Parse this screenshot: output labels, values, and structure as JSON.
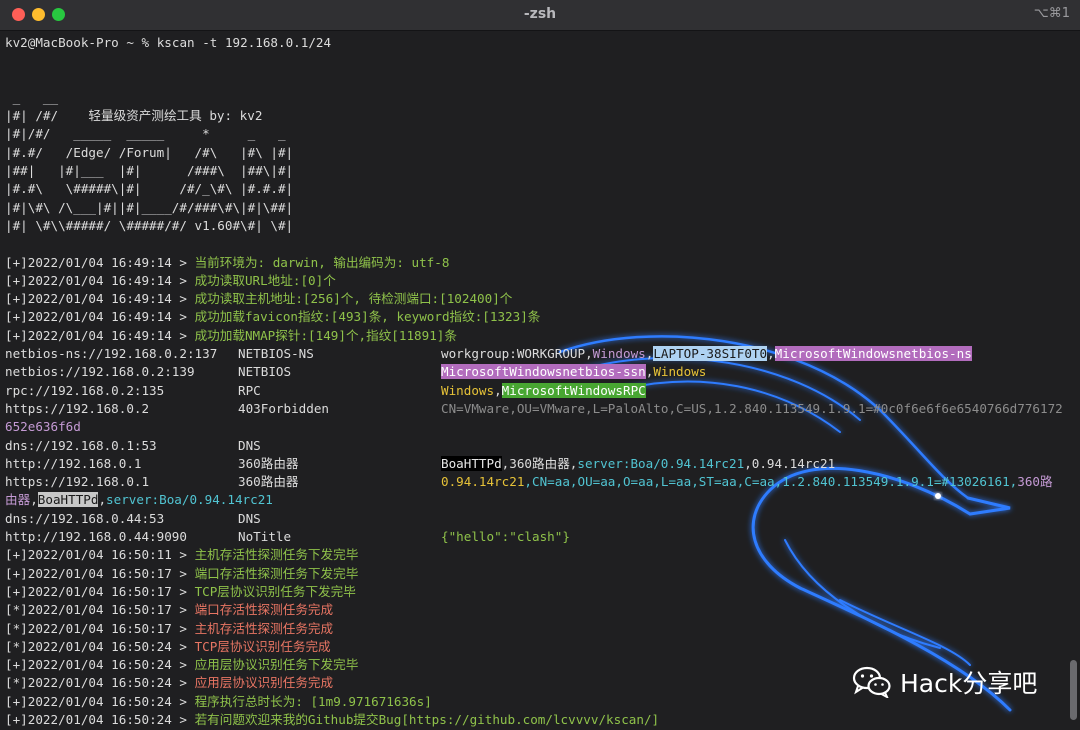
{
  "window": {
    "title": "-zsh",
    "shortcut": "⌥⌘1"
  },
  "prompt": {
    "user_host": "kv2@MacBook-Pro",
    "path": "~",
    "symbol": "%",
    "command": "kscan -t 192.168.0.1/24"
  },
  "banner": [
    " _   __",
    "|#| /#/    轻量级资产测绘工具 by: kv2",
    "|#|/#/   _____  _____     *     _   _",
    "|#.#/   /Edge/ /Forum|   /#\\   |#\\ |#|",
    "|##|   |#|___  |#|      /###\\  |##\\|#|",
    "|#.#\\   \\#####\\|#|     /#/_\\#\\ |#.#.#|",
    "|#|\\#\\ /\\___|#||#|____/#/###\\#\\|#|\\##|",
    "|#| \\#\\\\#####/ \\#####/#/ v1.60#\\#| \\#|"
  ],
  "log_start": [
    {
      "tag": "[+]",
      "time": "2022/01/04 16:49:14",
      "msg": "当前环境为: darwin, 输出编码为: utf-8"
    },
    {
      "tag": "[+]",
      "time": "2022/01/04 16:49:14",
      "msg": "成功读取URL地址:[0]个"
    },
    {
      "tag": "[+]",
      "time": "2022/01/04 16:49:14",
      "msg": "成功读取主机地址:[256]个, 待检测端口:[102400]个"
    },
    {
      "tag": "[+]",
      "time": "2022/01/04 16:49:14",
      "msg": "成功加载favicon指纹:[493]条, keyword指纹:[1323]条"
    },
    {
      "tag": "[+]",
      "time": "2022/01/04 16:49:14",
      "msg": "成功加载NMAP探针:[149]个,指纹[11891]条"
    }
  ],
  "results": {
    "r1": {
      "url": "netbios-ns://192.168.0.2:137",
      "name": "NETBIOS-NS",
      "d1": "workgroup:WORKGROUP",
      "d2": ",",
      "d3": "Windows",
      "d4": ",",
      "d5": "LAPTOP-38SIF0T0",
      "d6": ",",
      "d7": "MicrosoftWindowsnetbios-ns"
    },
    "r2": {
      "url": "netbios://192.168.0.2:139",
      "name": "NETBIOS",
      "d1": "MicrosoftWindowsnetbios-ssn",
      "d2": ",",
      "d3": "Windows"
    },
    "r3": {
      "url": "rpc://192.168.0.2:135",
      "name": "RPC",
      "d1": "Windows",
      "d2": ",",
      "d3": "MicrosoftWindowsRPC"
    },
    "r4": {
      "url": "https://192.168.0.2",
      "name": "403Forbidden",
      "d1": "CN=VMware,OU=VMware,L=PaloAlto,C=US,1.2.840.113549.1.9.1=#0c0f6e6f6e6540766d776172",
      "wrap": "652e636f6d"
    },
    "r5": {
      "url": "dns://192.168.0.1:53",
      "name": "DNS"
    },
    "r6": {
      "url": "http://192.168.0.1",
      "name": "360路由器",
      "d1": "BoaHTTPd",
      "d2": ",360路由器,",
      "d3": "server:Boa/0.94.14rc21",
      "d4": ",0.94.14rc21"
    },
    "r7": {
      "url": "https://192.168.0.1",
      "name": "360路由器",
      "d1": "0.94.14rc21",
      "d2": ",CN=aa,OU=aa,O=aa,L=aa,ST=aa,C=aa,1.2.840.113549.1.9.1=#13026161,",
      "d3": "360路",
      "w1": "由器",
      "w2": ",",
      "w3": "BoaHTTPd",
      "w4": ",",
      "w5": "server:Boa/0.94.14rc21"
    },
    "r8": {
      "url": "dns://192.168.0.44:53",
      "name": "DNS"
    },
    "r9": {
      "url": "http://192.168.0.44:9090",
      "name": "NoTitle",
      "d1": "{\"hello\":\"clash\"}"
    }
  },
  "log_end": [
    {
      "tag": "[+]",
      "time": "2022/01/04 16:50:11",
      "msg": "主机存活性探测任务下发完毕"
    },
    {
      "tag": "[+]",
      "time": "2022/01/04 16:50:17",
      "msg": "端口存活性探测任务下发完毕"
    },
    {
      "tag": "[+]",
      "time": "2022/01/04 16:50:17",
      "msg": "TCP层协议识别任务下发完毕"
    },
    {
      "tag": "[*]",
      "time": "2022/01/04 16:50:17",
      "msg": "端口存活性探测任务完成"
    },
    {
      "tag": "[*]",
      "time": "2022/01/04 16:50:17",
      "msg": "主机存活性探测任务完成"
    },
    {
      "tag": "[*]",
      "time": "2022/01/04 16:50:24",
      "msg": "TCP层协议识别任务完成"
    },
    {
      "tag": "[+]",
      "time": "2022/01/04 16:50:24",
      "msg": "应用层协议识别任务下发完毕"
    },
    {
      "tag": "[*]",
      "time": "2022/01/04 16:50:24",
      "msg": "应用层协议识别任务完成"
    },
    {
      "tag": "[+]",
      "time": "2022/01/04 16:50:24",
      "msg": "程序执行总时长为: [1m9.971671636s]"
    },
    {
      "tag": "[+]",
      "time": "2022/01/04 16:50:24",
      "msg": "若有问题欢迎来我的Github提交Bug[https://github.com/lcvvvv/kscan/]"
    }
  ],
  "watermark": {
    "text": "Hack分享吧",
    "icon": "wechat-icon"
  },
  "colors": {
    "background": "#1f1f21",
    "text": "#dcdcdc",
    "green": "#8fc24a",
    "red": "#e87563",
    "yellow": "#e6c238",
    "purple": "#c49ad4",
    "cyan": "#51c4d2",
    "dragon": "#2f7cff"
  }
}
